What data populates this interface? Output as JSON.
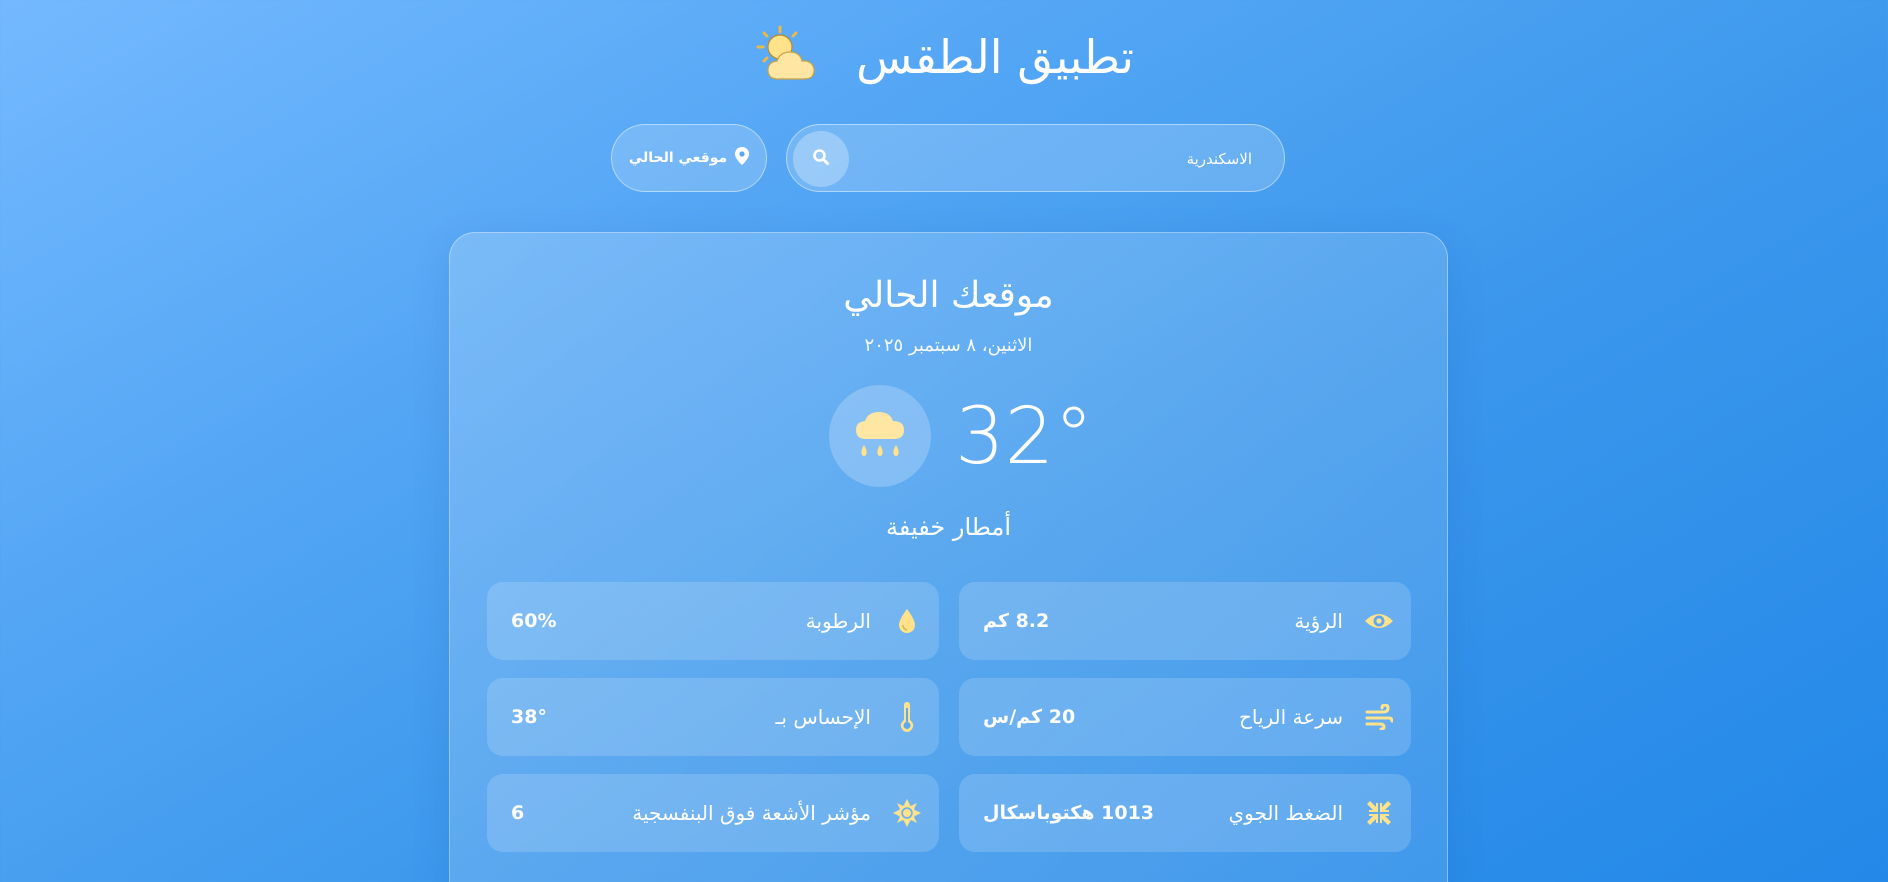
{
  "app": {
    "title": "تطبيق الطقس",
    "title_icon": "sun-behind-cloud-icon"
  },
  "search": {
    "value": "الاسكندرية",
    "placeholder": "",
    "button_icon": "search-icon"
  },
  "location_button": {
    "label": "موقعي الحالي",
    "icon": "map-pin-icon"
  },
  "current": {
    "location": "موقعك الحالي",
    "date": "الاثنين، ٨ سبتمبر ٢٠٢٥",
    "temperature": "32°",
    "condition_icon": "rain-cloud-icon",
    "description": "أمطار خفيفة"
  },
  "details": [
    {
      "icon": "eye-icon",
      "label": "الرؤية",
      "value": "8.2 كم"
    },
    {
      "icon": "droplet-icon",
      "label": "الرطوبة",
      "value": "60%"
    },
    {
      "icon": "wind-icon",
      "label": "سرعة الرياح",
      "value": "20 كم/س"
    },
    {
      "icon": "thermometer-icon",
      "label": "الإحساس بـ",
      "value": "38°"
    },
    {
      "icon": "compress-icon",
      "label": "الضغط الجوي",
      "value": "1013 هكتوباسكال"
    },
    {
      "icon": "sun-icon",
      "label": "مؤشر الأشعة فوق البنفسجية",
      "value": "6"
    }
  ],
  "colors": {
    "background_start": "#74b9ff",
    "background_end": "#2388e8",
    "icon_accent": "#ffe28a",
    "text": "#ffffff"
  }
}
